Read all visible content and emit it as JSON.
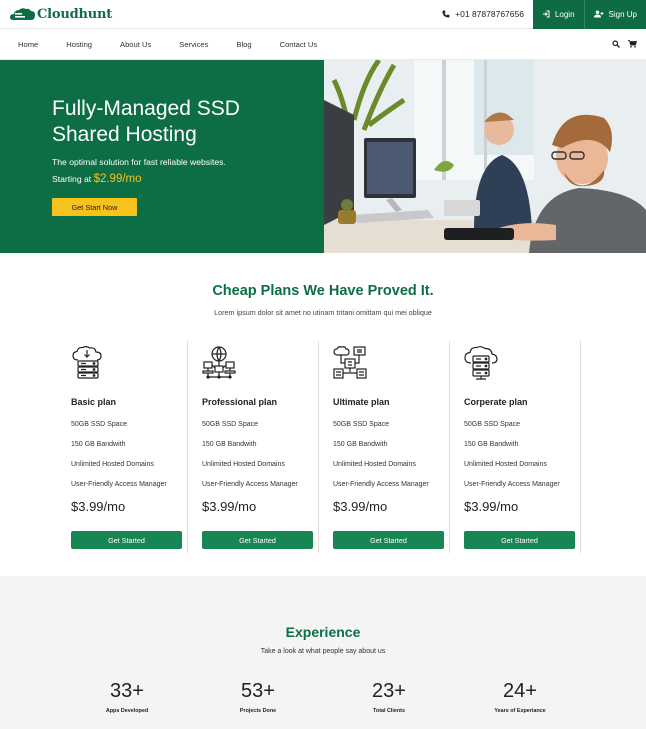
{
  "brand": {
    "name": "Cloudhunt",
    "color": "#0d6e45"
  },
  "topbar": {
    "phone": "+01 87878767656",
    "login_label": "Login",
    "signup_label": "Sign Up"
  },
  "nav": {
    "items": [
      {
        "label": "Home"
      },
      {
        "label": "Hosting"
      },
      {
        "label": "About Us"
      },
      {
        "label": "Services"
      },
      {
        "label": "Blog"
      },
      {
        "label": "Contact Us"
      }
    ],
    "icons": [
      "search-icon",
      "cart-icon"
    ]
  },
  "hero": {
    "title": "Fully-Managed SSD Shared Hosting",
    "subtitle": "The optimal solution for fast reliable websites.",
    "starting_text": "Starting at",
    "price": "$2.99/mo",
    "button_label": "Get Start Now",
    "accent": "#f7c21b"
  },
  "plans_section": {
    "title": "Cheap Plans We Have Proved It.",
    "subtitle": "Lorem ipsum dolor sit amet no utinam tritani omittam qui mei oblique",
    "plans": [
      {
        "name": "Basic plan",
        "icon": "cloud-server-icon",
        "features": [
          "50GB SSD Space",
          "150 GB Bandwith",
          "Unlimited Hosted Domains",
          "User-Friendly Access Manager"
        ],
        "price": "$3.99/mo",
        "button_label": "Get Started"
      },
      {
        "name": "Professional plan",
        "icon": "globe-network-icon",
        "features": [
          "50GB SSD Space",
          "150 GB Bandwith",
          "Unlimited Hosted Domains",
          "User-Friendly Access Manager"
        ],
        "price": "$3.99/mo",
        "button_label": "Get Started"
      },
      {
        "name": "Ultimate plan",
        "icon": "cloud-network-icon",
        "features": [
          "50GB SSD Space",
          "150 GB Bandwith",
          "Unlimited Hosted Domains",
          "User-Friendly Access Manager"
        ],
        "price": "$3.99/mo",
        "button_label": "Get Started"
      },
      {
        "name": "Corperate plan",
        "icon": "cloud-database-icon",
        "features": [
          "50GB SSD Space",
          "150 GB Bandwith",
          "Unlimited Hosted Domains",
          "User-Friendly Access Manager"
        ],
        "price": "$3.99/mo",
        "button_label": "Get Started"
      }
    ]
  },
  "experience": {
    "title": "Experience",
    "subtitle": "Take a look at what people say about us",
    "stats": [
      {
        "value": "33+",
        "label": "Apps Developed"
      },
      {
        "value": "53+",
        "label": "Projects Done"
      },
      {
        "value": "23+",
        "label": "Total Clients"
      },
      {
        "value": "24+",
        "label": "Years of Experiance"
      }
    ]
  }
}
